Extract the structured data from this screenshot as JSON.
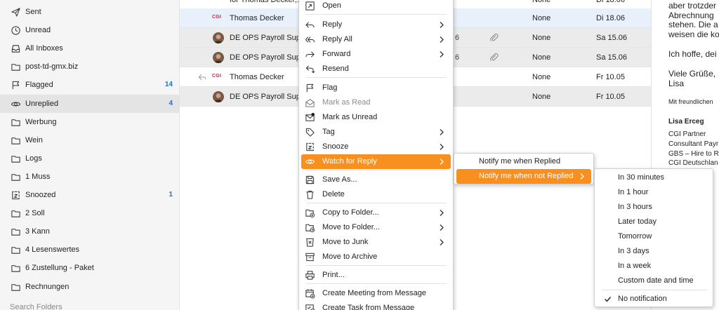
{
  "sidebar": {
    "items": [
      {
        "label": "Sent",
        "icon": "send-icon",
        "count": ""
      },
      {
        "label": "Unread",
        "icon": "clock-icon",
        "count": ""
      },
      {
        "label": "All Inboxes",
        "icon": "inbox-icon",
        "count": ""
      },
      {
        "label": "post-td-gmx.biz",
        "icon": "folder-icon",
        "count": ""
      },
      {
        "label": "Flagged",
        "icon": "flag-icon",
        "count": "14"
      },
      {
        "label": "Unreplied",
        "icon": "eye-icon",
        "count": "4"
      },
      {
        "label": "Werbung",
        "icon": "folder-icon",
        "count": ""
      },
      {
        "label": "Wein",
        "icon": "folder-icon",
        "count": ""
      },
      {
        "label": "Logs",
        "icon": "folder-icon",
        "count": ""
      },
      {
        "label": "1 Muss",
        "icon": "folder-icon",
        "count": ""
      },
      {
        "label": "Snoozed",
        "icon": "snooze-icon",
        "count": "1"
      },
      {
        "label": "2 Soll",
        "icon": "folder-icon",
        "count": ""
      },
      {
        "label": "3 Kann",
        "icon": "folder-icon",
        "count": ""
      },
      {
        "label": "4 Lesenswertes",
        "icon": "folder-icon",
        "count": ""
      },
      {
        "label": "6 Zustellung - Paket",
        "icon": "folder-icon",
        "count": ""
      },
      {
        "label": "Rechnungen",
        "icon": "folder-icon",
        "count": ""
      }
    ],
    "search_placeholder": "Search Folders"
  },
  "messages": [
    {
      "sender": "for Thomas Decker,...",
      "fragment": "",
      "tag": "None",
      "date": "Di 18.06",
      "avatar": "none",
      "replied": false,
      "attachment": false
    },
    {
      "sender": "Thomas Decker",
      "fragment": "",
      "tag": "None",
      "date": "Di 18.06",
      "avatar": "cgi",
      "replied": false,
      "attachment": false
    },
    {
      "sender": "DE OPS Payroll Sup...",
      "fragment": "6",
      "tag": "None",
      "date": "Sa 15.06",
      "avatar": "photo",
      "replied": false,
      "attachment": true
    },
    {
      "sender": "DE OPS Payroll Sup...",
      "fragment": "6",
      "tag": "None",
      "date": "Sa 15.06",
      "avatar": "photo",
      "replied": false,
      "attachment": true
    },
    {
      "sender": "Thomas Decker",
      "fragment": "",
      "tag": "None",
      "date": "Fr 10.05",
      "avatar": "cgi",
      "replied": true,
      "attachment": false
    },
    {
      "sender": "DE OPS Payroll Sup...",
      "fragment": "",
      "tag": "None",
      "date": "Fr 10.05",
      "avatar": "photo",
      "replied": false,
      "attachment": false
    }
  ],
  "cgi_logo_text": "CGI",
  "reader": {
    "lines": [
      "aber trotzder",
      "Abrechnung",
      "stehen. Die a",
      "weisen die ko",
      "Ich hoffe, dei",
      "Viele Grüße,",
      "Lisa",
      "Mit freundlichen",
      "Lisa Erceg",
      "CGI Partner",
      "Consultant Payr",
      "GBS – Hire to R",
      "CGI Deutschlan"
    ]
  },
  "context_menu": {
    "items": [
      {
        "label": "Open",
        "icon": "open-icon",
        "submenu": false,
        "disabled": false
      },
      {
        "label": "Reply",
        "icon": "reply-icon",
        "submenu": true,
        "disabled": false
      },
      {
        "label": "Reply All",
        "icon": "reply-all-icon",
        "submenu": true,
        "disabled": false
      },
      {
        "label": "Forward",
        "icon": "forward-icon",
        "submenu": true,
        "disabled": false
      },
      {
        "label": "Resend",
        "icon": "resend-icon",
        "submenu": false,
        "disabled": false
      },
      {
        "label": "Flag",
        "icon": "flag-icon",
        "submenu": false,
        "disabled": false
      },
      {
        "label": "Mark as Read",
        "icon": "mail-open-icon",
        "submenu": false,
        "disabled": true
      },
      {
        "label": "Mark as Unread",
        "icon": "mail-unread-icon",
        "submenu": false,
        "disabled": false
      },
      {
        "label": "Tag",
        "icon": "tag-icon",
        "submenu": true,
        "disabled": false
      },
      {
        "label": "Snooze",
        "icon": "snooze-icon",
        "submenu": true,
        "disabled": false
      },
      {
        "label": "Watch for Reply",
        "icon": "eye-icon",
        "submenu": true,
        "disabled": false
      },
      {
        "label": "Save As...",
        "icon": "save-icon",
        "submenu": false,
        "disabled": false
      },
      {
        "label": "Delete",
        "icon": "trash-icon",
        "submenu": false,
        "disabled": false
      },
      {
        "label": "Copy to Folder...",
        "icon": "copy-folder-icon",
        "submenu": true,
        "disabled": false
      },
      {
        "label": "Move to Folder...",
        "icon": "move-folder-icon",
        "submenu": true,
        "disabled": false
      },
      {
        "label": "Move to Junk",
        "icon": "junk-icon",
        "submenu": true,
        "disabled": false
      },
      {
        "label": "Move to Archive",
        "icon": "archive-icon",
        "submenu": false,
        "disabled": false
      },
      {
        "label": "Print...",
        "icon": "print-icon",
        "submenu": false,
        "disabled": false
      },
      {
        "label": "Create Meeting from Message",
        "icon": "calendar-add-icon",
        "submenu": false,
        "disabled": false
      },
      {
        "label": "Create Task from Message",
        "icon": "task-add-icon",
        "submenu": false,
        "disabled": false
      }
    ],
    "active_label": "Watch for Reply"
  },
  "watch_submenu": {
    "items": [
      "Notify me when Replied",
      "Notify me when not Replied"
    ],
    "active": "Notify me when not Replied"
  },
  "notify_submenu": {
    "items": [
      "In 30 minutes",
      "In 1 hour",
      "In 3 hours",
      "Later today",
      "Tomorrow",
      "In 3 days",
      "In a week",
      "Custom date and time",
      "No notification"
    ],
    "checked": "No notification"
  },
  "colors": {
    "accent": "#f7901e",
    "count": "#1a73e8",
    "cgi_red": "#e31937"
  }
}
